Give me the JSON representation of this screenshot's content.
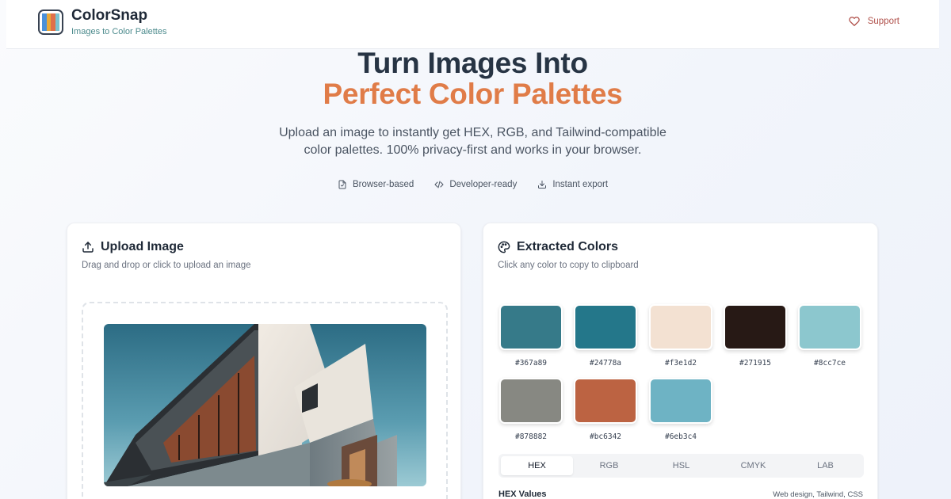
{
  "header": {
    "brand_name": "ColorSnap",
    "brand_tagline": "Images to Color Palettes",
    "support_label": "Support",
    "logo_colors": [
      "#4a90d9",
      "#e8a838",
      "#e0704a",
      "#7bc3d0"
    ]
  },
  "hero": {
    "title_line1": "Turn Images Into",
    "title_line2": "Perfect Color Palettes",
    "description_line1": "Upload an image to instantly get HEX, RGB, and Tailwind-compatible",
    "description_line2": "color palettes. 100% privacy-first and works in your browser.",
    "features": [
      {
        "icon": "browser-file-icon",
        "label": "Browser-based"
      },
      {
        "icon": "code-icon",
        "label": "Developer-ready"
      },
      {
        "icon": "download-icon",
        "label": "Instant export"
      }
    ]
  },
  "upload": {
    "title": "Upload Image",
    "subtitle": "Drag and drop or click to upload an image"
  },
  "extracted": {
    "title": "Extracted Colors",
    "subtitle": "Click any color to copy to clipboard",
    "swatches": [
      {
        "hex": "#367a89"
      },
      {
        "hex": "#24778a"
      },
      {
        "hex": "#f3e1d2"
      },
      {
        "hex": "#271915"
      },
      {
        "hex": "#8cc7ce"
      },
      {
        "hex": "#878882"
      },
      {
        "hex": "#bc6342"
      },
      {
        "hex": "#6eb3c4"
      }
    ],
    "tabs": [
      "HEX",
      "RGB",
      "HSL",
      "CMYK",
      "LAB"
    ],
    "active_tab": "HEX",
    "values_title": "HEX Values",
    "values_hint": "Web design, Tailwind, CSS"
  },
  "colors": {
    "accent": "#e07c48",
    "support": "#b0504a",
    "tagline": "#4b8a8c"
  }
}
